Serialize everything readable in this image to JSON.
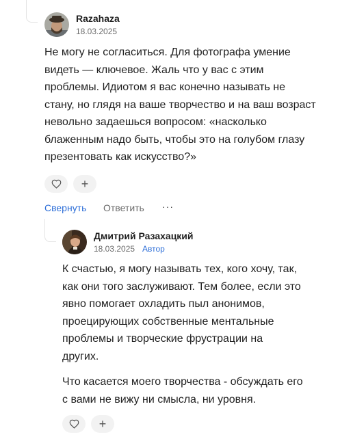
{
  "comment": {
    "author": "Razahaza",
    "date": "18.03.2025",
    "text": "Не могу не согласиться. Для фотографа умение видеть — ключевое. Жаль что у вас с этим проблемы. Идиотом я вас конечно называть не стану, но глядя на ваше творчество и на ваш возраст невольно задаешься вопросом: «насколько блаженным надо быть, чтобы это на голубом глазу презентовать как искусство?»",
    "like_icon": "heart-icon",
    "add_icon": "plus-icon",
    "add_label": "+",
    "collapse_label": "Свернуть",
    "reply_label": "Ответить",
    "more_label": "···"
  },
  "reply": {
    "author": "Дмитрий Разахацкий",
    "date": "18.03.2025",
    "badge": "Автор",
    "paragraph1": "К счастью, я могу называть тех, кого хочу, так, как они того заслуживают. Тем более, если это явно помогает охладить пыл анонимов, проецирующих собственные ментальные проблемы и творческие фрустрации на других.",
    "paragraph2": "Что касается моего творчества - обсуждать его с вами не вижу ни смысла, ни уровня.",
    "like_icon": "heart-icon",
    "add_icon": "plus-icon",
    "add_label": "+"
  },
  "colors": {
    "accent": "#2e6fd8",
    "text": "#1f1f1f",
    "muted": "#6b6b6b",
    "pill_bg": "#f2f2f2"
  }
}
